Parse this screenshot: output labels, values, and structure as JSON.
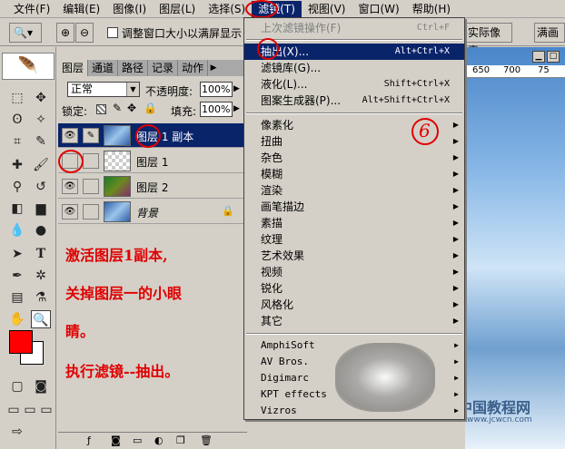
{
  "menubar": {
    "items": [
      "文件(F)",
      "编辑(E)",
      "图像(I)",
      "图层(L)",
      "选择(S)",
      "滤镜(T)",
      "视图(V)",
      "窗口(W)",
      "帮助(H)"
    ]
  },
  "options": {
    "checkbox_label": "调整窗口大小以满屏显示",
    "btn_actual": "实际像素",
    "btn_fit": "满画布"
  },
  "layers": {
    "tabs": [
      "图层",
      "通道",
      "路径",
      "记录",
      "动作"
    ],
    "blend_mode": "正常",
    "opacity_label": "不透明度:",
    "opacity_value": "100%",
    "lock_label": "锁定:",
    "fill_label": "填充:",
    "fill_value": "100%",
    "items": [
      {
        "name": "图层 1 副本",
        "selected": true
      },
      {
        "name": "图层 1",
        "selected": false
      },
      {
        "name": "图层 2",
        "selected": false
      },
      {
        "name": "背景",
        "selected": false
      }
    ]
  },
  "notes": [
    "激活图层1副本,",
    "关掉图层一的小眼",
    "睛。",
    "执行滤镜--抽出。"
  ],
  "ruler": [
    "650",
    "700",
    "75"
  ],
  "filter_menu": {
    "last_filter": "上次滤镜操作(F)",
    "last_filter_shortcut": "Ctrl+F",
    "group1": [
      {
        "label": "抽出(X)...",
        "shortcut": "Alt+Ctrl+X"
      },
      {
        "label": "滤镜库(G)...",
        "shortcut": ""
      },
      {
        "label": "液化(L)...",
        "shortcut": "Shift+Ctrl+X"
      },
      {
        "label": "图案生成器(P)...",
        "shortcut": "Alt+Shift+Ctrl+X"
      }
    ],
    "group2": [
      "像素化",
      "扭曲",
      "杂色",
      "模糊",
      "渲染",
      "画笔描边",
      "素描",
      "纹理",
      "艺术效果",
      "视频",
      "锐化",
      "风格化",
      "其它"
    ],
    "group3": [
      "AmphiSoft",
      "AV Bros.",
      "Digimarc",
      "KPT effects",
      "Vizros"
    ]
  },
  "step_marker": "6",
  "watermark": {
    "line1": "中国教程网",
    "line2": "www.jcwcn.com"
  }
}
